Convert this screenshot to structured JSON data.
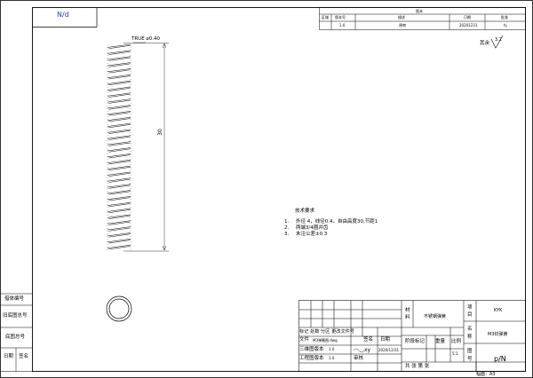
{
  "corner_code": "N/d",
  "revision_table": {
    "title": "版本",
    "headers": [
      "区域",
      "版本号",
      "描述",
      "日期",
      "批准"
    ],
    "row": [
      "",
      "1.0",
      "原审",
      "20201231",
      "hj"
    ]
  },
  "surface_finish": {
    "label": "其余",
    "value": "3.2"
  },
  "dimensions": {
    "wire_label": "TRUE",
    "wire_value": "0.40",
    "length": "30"
  },
  "tech_requirements": {
    "title": "技术要求",
    "items": [
      {
        "num": "1.",
        "text": "外径 4，线径0.4，自由高度30,节距1"
      },
      {
        "num": "2.",
        "text": "两端3/4圈并齿"
      },
      {
        "num": "3.",
        "text": "未注公差±0.3"
      }
    ]
  },
  "left_strip": [
    "借体编号",
    "旧底图总号",
    "底图总号",
    "日期",
    "签名"
  ],
  "title_block": {
    "material_label": "材料",
    "material_value": "不锈钢弹簧",
    "project_label": "项目",
    "project_value": "KYK",
    "name_label": "名称",
    "name_value": "M3铰弹簧",
    "drawing_label": "图号",
    "drawing_value": "p/N",
    "change_header": "标记 处数 分区 更改文件号",
    "sign_label": "签名",
    "date_label": "日期",
    "file_label": "文件",
    "file_value": "M3弹簧图.dwg",
    "design_label": "三维图版本",
    "design_value": "1.0",
    "drawing_ver_label": "工程图版本",
    "drawing_ver_value": "1.0",
    "signer": "xy",
    "sign_date": "2020/12/31",
    "review_label": "审核",
    "stage_label": "阶段标记",
    "weight_label": "重量",
    "scale_label": "比例",
    "scale_value": "5:1",
    "sheets_label": "共    张  第    张"
  },
  "sheet_size": "幅面：A3"
}
